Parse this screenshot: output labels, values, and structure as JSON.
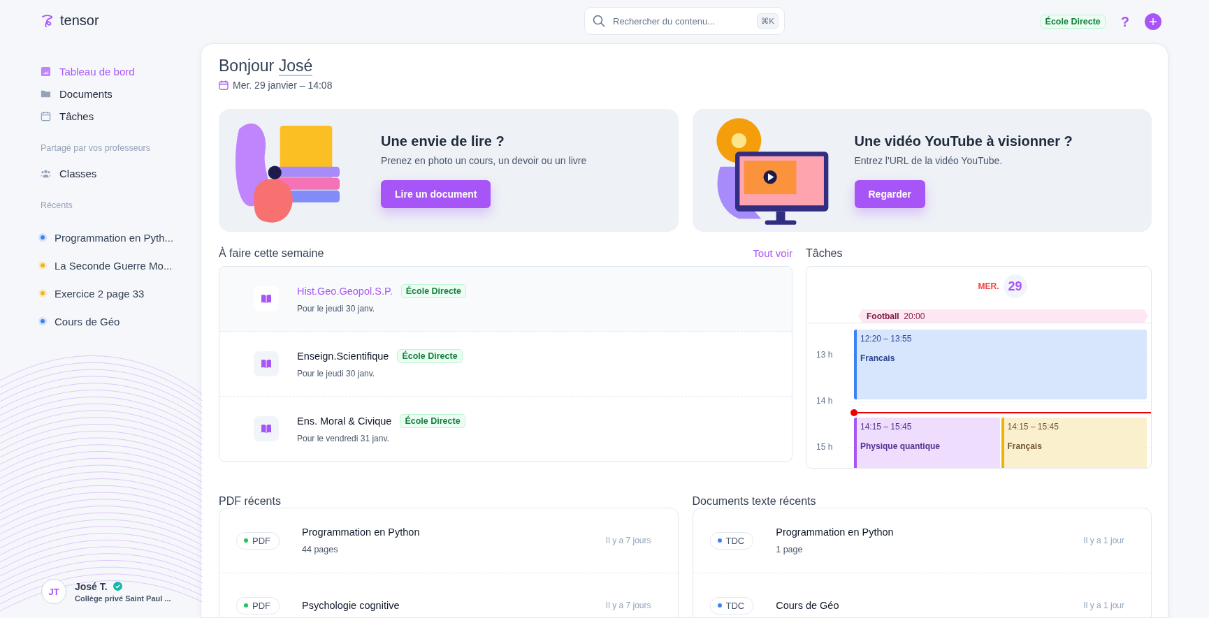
{
  "app": {
    "name": "tensor"
  },
  "search": {
    "placeholder": "Rechercher du contenu...",
    "shortcut": "⌘K"
  },
  "header": {
    "badge": "École Directe",
    "help": "?"
  },
  "sidebar": {
    "nav": [
      {
        "label": "Tableau de bord",
        "kind": "dashboard",
        "selected": true
      },
      {
        "label": "Documents",
        "kind": "folder",
        "selected": false
      },
      {
        "label": "Tâches",
        "kind": "calendar",
        "selected": false
      }
    ],
    "shared_title": "Partagé par vos professeurs",
    "shared": [
      {
        "label": "Classes",
        "kind": "users",
        "selected": false
      }
    ],
    "recent_title": "Récents",
    "recent": [
      {
        "label": "Programmation en Pyth...",
        "color": "#3b82f6"
      },
      {
        "label": "La Seconde Guerre Mo...",
        "color": "#f5b60b"
      },
      {
        "label": "Exercice 2 page 33",
        "color": "#f5b60b"
      },
      {
        "label": "Cours de Géo",
        "color": "#3b82f6"
      }
    ],
    "user": {
      "initials": "JT",
      "name": "José T.",
      "verified": true,
      "school": "Collège privé Saint Paul ..."
    }
  },
  "greeting": {
    "text": "Bonjour",
    "name": "José",
    "date": "Mer. 29 janvier – 14:08"
  },
  "promos": [
    {
      "kind": "read",
      "title": "Une envie de lire ?",
      "subtitle": "Prenez en photo un cours, un devoir ou un livre",
      "button": "Lire un document"
    },
    {
      "kind": "video",
      "title": "Une vidéo YouTube à visionner ?",
      "subtitle": "Entrez l'URL de la vidéo YouTube.",
      "button": "Regarder"
    }
  ],
  "todo": {
    "title": "À faire cette semaine",
    "link": "Tout voir",
    "items": [
      {
        "subject": "Hist.Geo.Geopol.S.P.",
        "source": "École Directe",
        "due": "Pour le jeudi 30 janv.",
        "selected": true
      },
      {
        "subject": "Enseign.Scientifique",
        "source": "École Directe",
        "due": "Pour le jeudi 30 janv.",
        "selected": false
      },
      {
        "subject": "Ens. Moral & Civique",
        "source": "École Directe",
        "due": "Pour le vendredi 31 janv.",
        "selected": false
      }
    ]
  },
  "calendar": {
    "title": "Tâches",
    "weekday": "MER.",
    "day": "29",
    "allday": [
      {
        "name": "Football",
        "time": "20:00"
      }
    ],
    "hours": [
      "13 h",
      "14 h",
      "15 h"
    ],
    "events": [
      {
        "time": "12:20 – 13:55",
        "name": "Francais",
        "color": "#3b82f6"
      },
      {
        "time": "14:15 – 15:45",
        "name": "Physique quantique",
        "color": "#a855f7"
      },
      {
        "time": "14:15 – 15:45",
        "name": "Français",
        "color": "#eab308"
      }
    ]
  },
  "pdfs": {
    "title": "PDF récents",
    "items": [
      {
        "tag": "PDF",
        "color": "#22c55e",
        "title": "Programmation en Python",
        "subtitle": "44 pages",
        "age": "Il y a 7 jours"
      },
      {
        "tag": "PDF",
        "color": "#22c55e",
        "title": "Psychologie cognitive",
        "age": "Il y a 7 jours"
      }
    ]
  },
  "texts": {
    "title": "Documents texte récents",
    "items": [
      {
        "tag": "TDC",
        "color": "#3b82f6",
        "title": "Programmation en Python",
        "subtitle": "1 page",
        "age": "Il y a 1 jour"
      },
      {
        "tag": "TDC",
        "color": "#3b82f6",
        "title": "Cours de Géo",
        "age": "Il y a 1 jour"
      }
    ]
  }
}
